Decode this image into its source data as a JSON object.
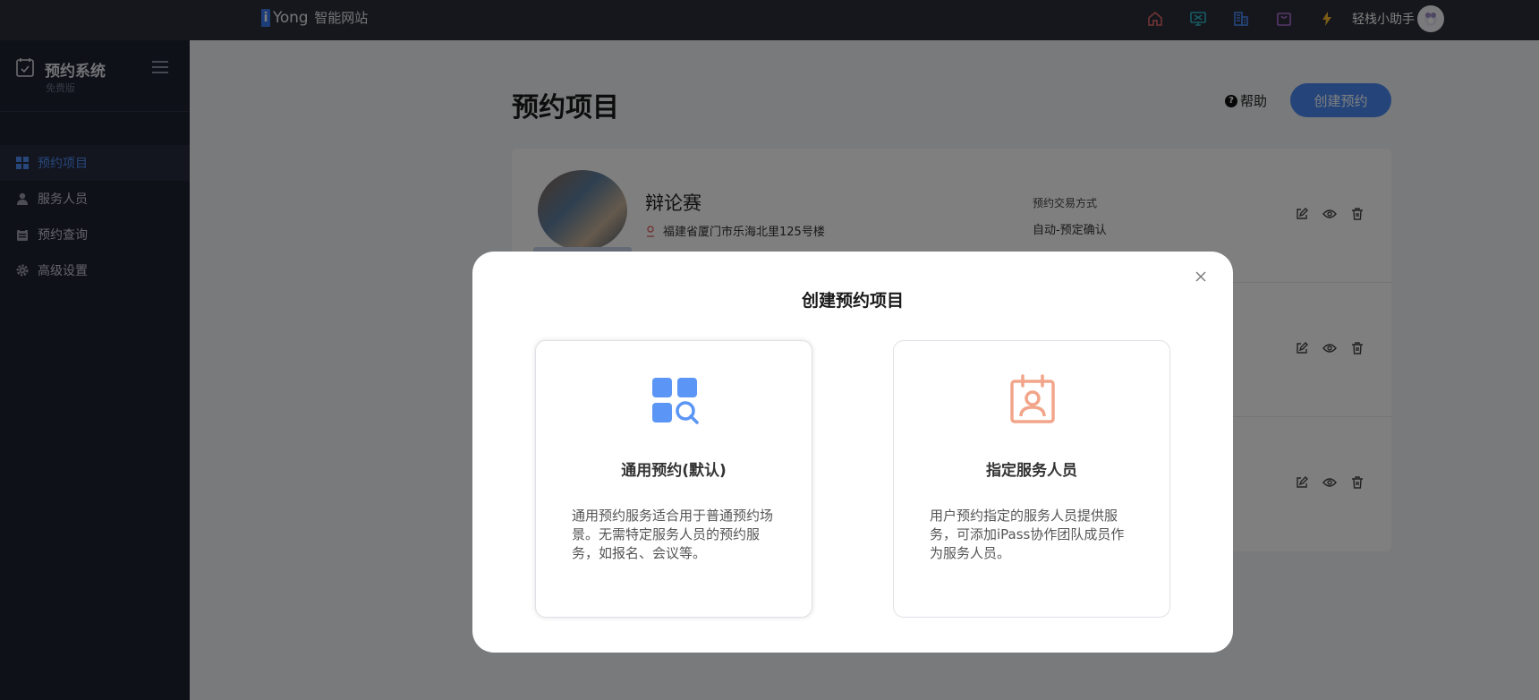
{
  "topbar": {
    "logo_mark": "i",
    "brand": "Yong",
    "brand_sub": "智能网站",
    "icons": [
      "home-icon",
      "monitor-icon",
      "building-icon",
      "bag-icon",
      "lightning-icon"
    ],
    "user_name": "轻栈小助手"
  },
  "sidebar": {
    "title": "预约系统",
    "subtitle": "免费版",
    "items": [
      {
        "label": "预约项目",
        "icon": "grid-icon",
        "active": true
      },
      {
        "label": "服务人员",
        "icon": "person-icon",
        "active": false
      },
      {
        "label": "预约查询",
        "icon": "clipboard-icon",
        "active": false
      },
      {
        "label": "高级设置",
        "icon": "gear-icon",
        "active": false
      }
    ]
  },
  "main": {
    "page_title": "预约项目",
    "help_icon_glyph": "?",
    "help_label": "帮助",
    "create_button": "创建预约",
    "rows": [
      {
        "name": "辩论赛",
        "address": "福建省厦门市乐海北里125号楼",
        "meta_label": "预约交易方式",
        "meta_value": "自动-预定确认"
      }
    ]
  },
  "modal": {
    "title": "创建预约项目",
    "options": [
      {
        "title": "通用预约(默认)",
        "icon": "grid-search-icon",
        "desc": "通用预约服务适合用于普通预约场景。无需特定服务人员的预约服务，如报名、会议等。"
      },
      {
        "title": "指定服务人员",
        "icon": "staff-calendar-icon",
        "desc": "用户预约指定的服务人员提供服务，可添加iPass协作团队成员作为服务人员。"
      }
    ]
  },
  "colors": {
    "topbar_bg": "#2d2f3a",
    "sidebar_bg": "#1f2233",
    "accent": "#4a8af5",
    "icon_orange": "#f2a58a"
  }
}
